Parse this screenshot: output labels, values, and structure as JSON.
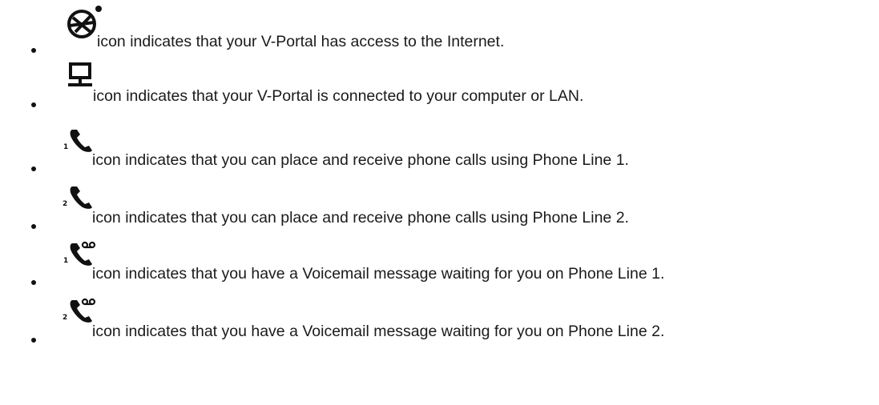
{
  "list": {
    "items": [
      {
        "icon": "internet-globe-icon",
        "text": "icon indicates that your V-Portal has access to the Internet."
      },
      {
        "icon": "lan-computer-icon",
        "text": "icon indicates that your V-Portal is connected to your computer or LAN."
      },
      {
        "icon": "phone-line-1-icon",
        "icon_label": "1",
        "text": "icon indicates that you can place and receive phone calls using Phone Line 1."
      },
      {
        "icon": "phone-line-2-icon",
        "icon_label": "2",
        "text": "icon indicates that you can place and receive phone calls using Phone Line 2."
      },
      {
        "icon": "voicemail-line-1-icon",
        "icon_label": "1",
        "text": "icon indicates that you have a Voicemail message waiting for you on Phone Line 1."
      },
      {
        "icon": "voicemail-line-2-icon",
        "icon_label": "2",
        "text": "icon indicates that you have a Voicemail message waiting for you on Phone Line 2."
      }
    ]
  },
  "colors": {
    "text": "#1a1a1a",
    "icon": "#111111"
  }
}
